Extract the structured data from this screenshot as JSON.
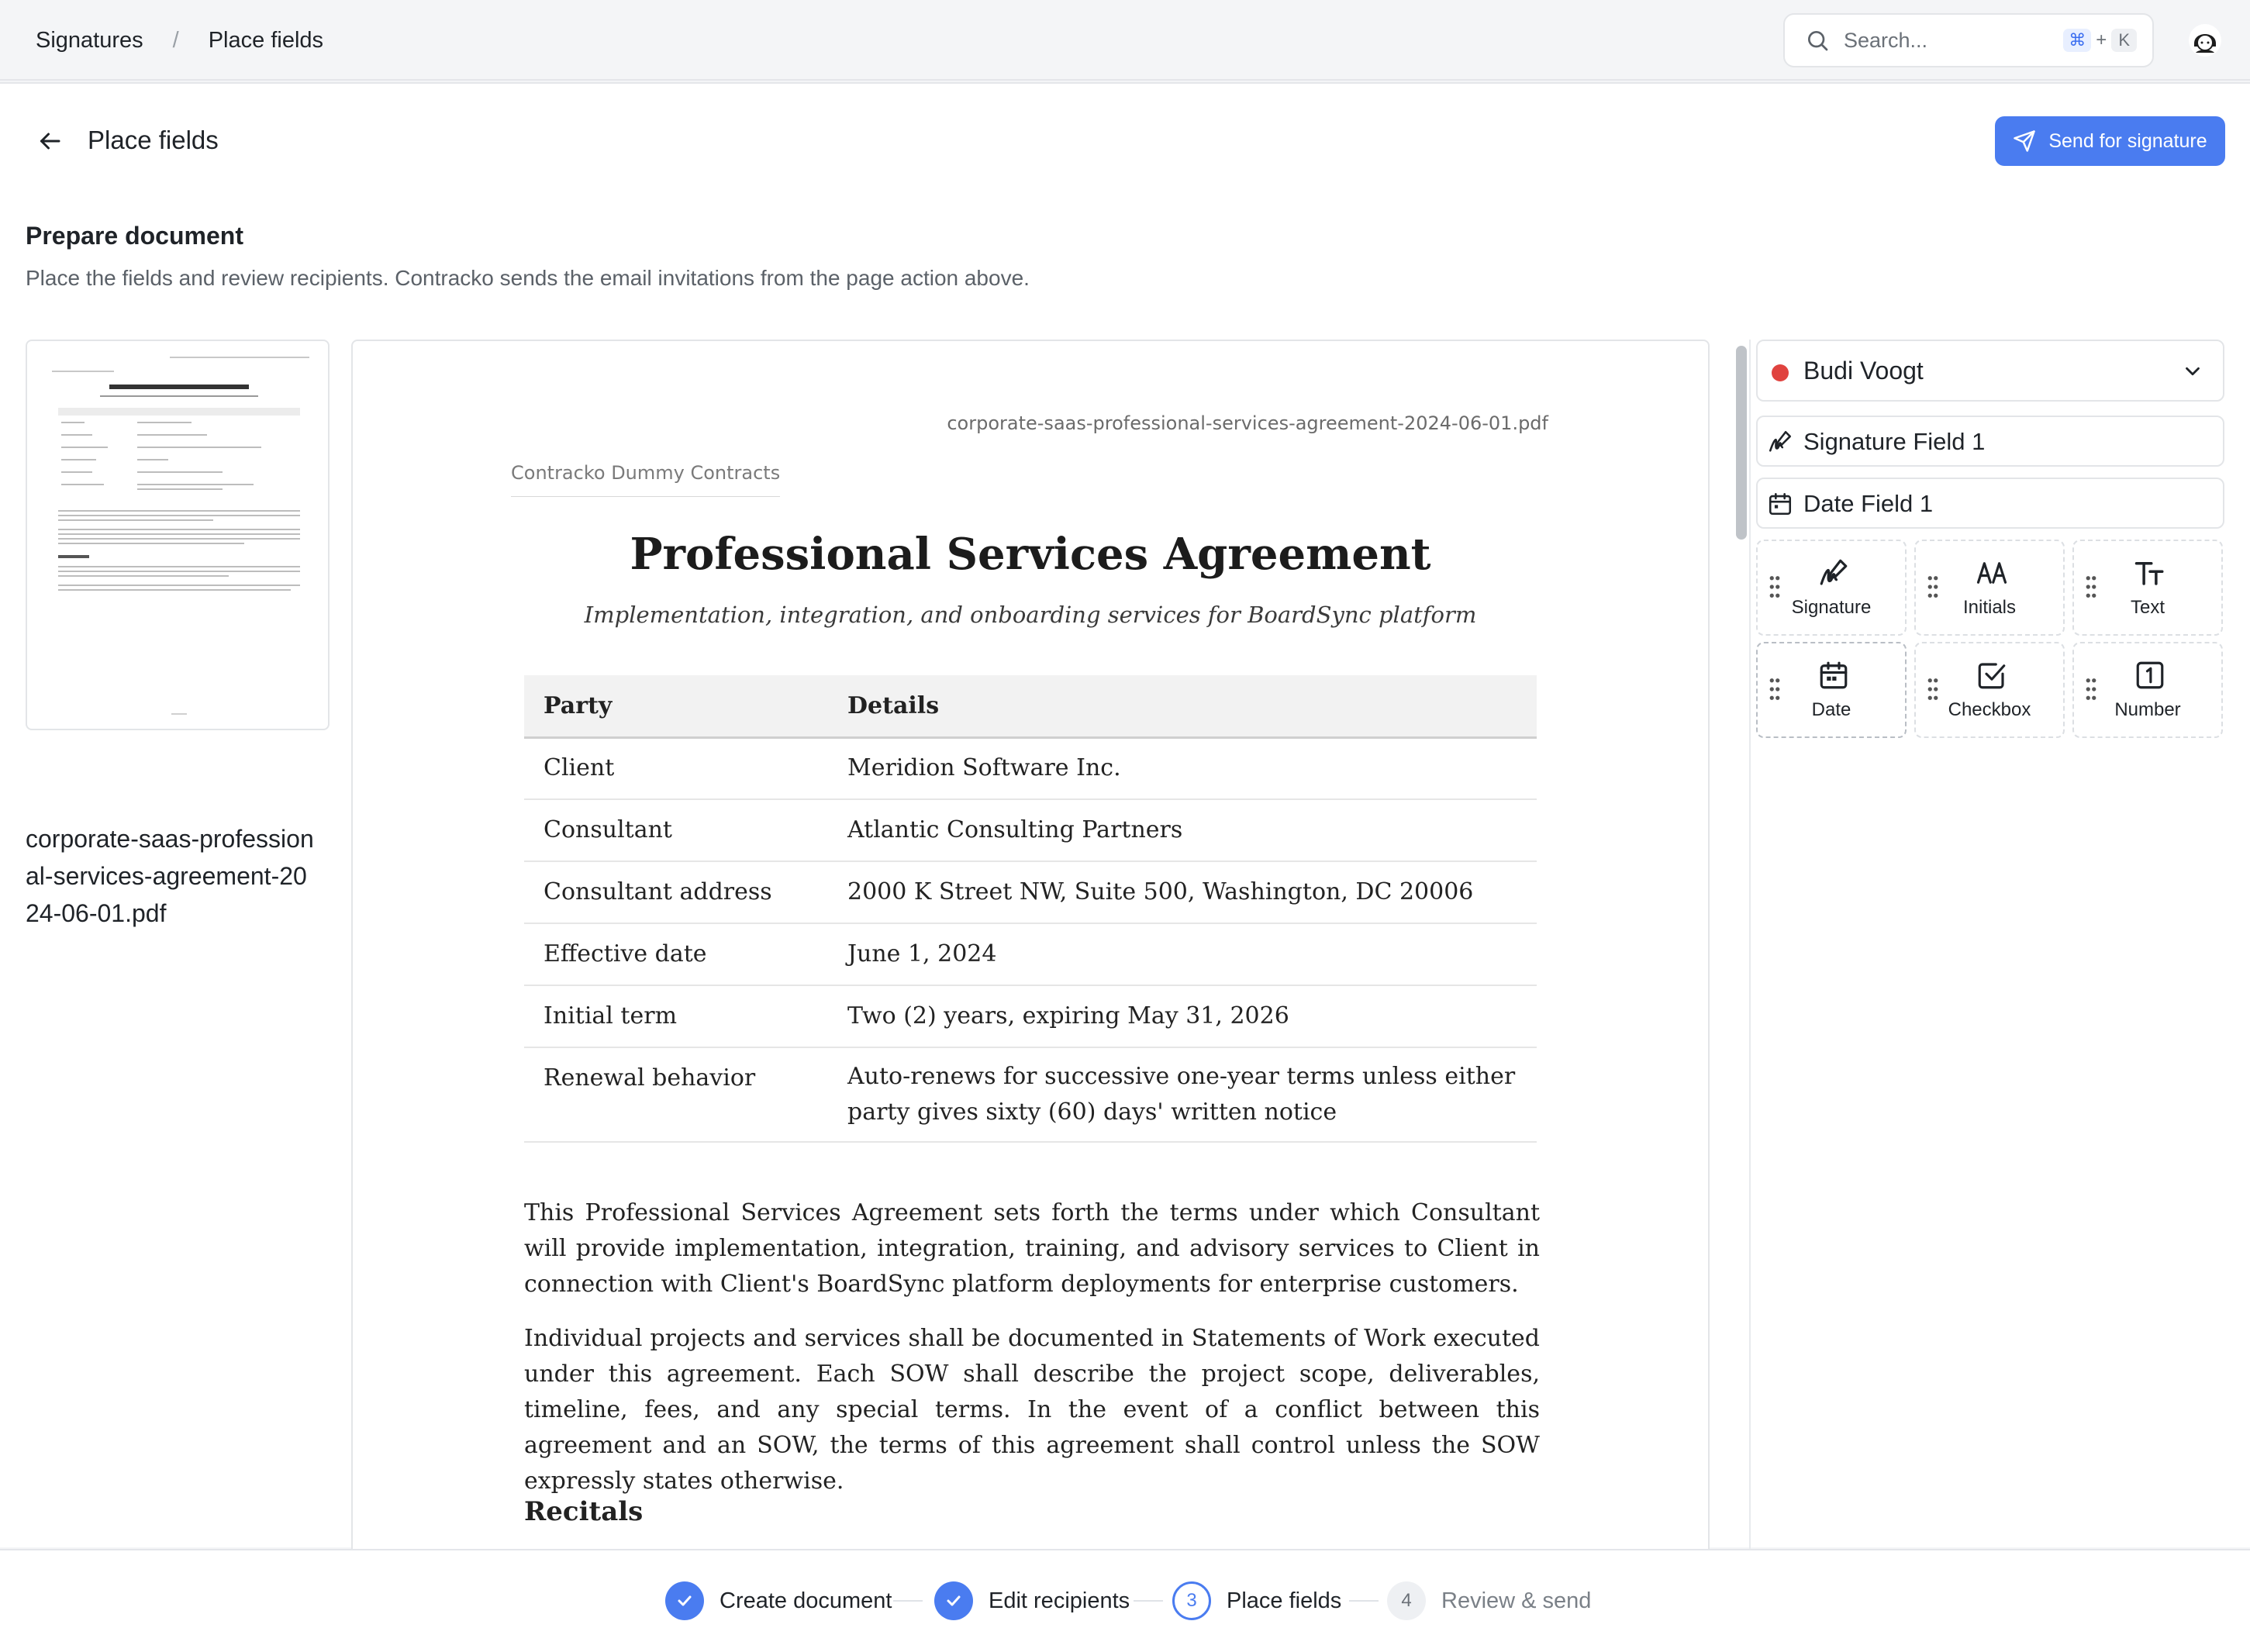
{
  "breadcrumb": {
    "root": "Signatures",
    "separator": "/",
    "current": "Place fields"
  },
  "search": {
    "placeholder": "Search...",
    "shortcut_modifier": "⌘",
    "shortcut_plus": "+",
    "shortcut_key": "K"
  },
  "header": {
    "title": "Place fields",
    "send_button": "Send for signature"
  },
  "section": {
    "title": "Prepare document",
    "subtitle": "Place the fields and review recipients. Contracko sends the email invitations from the page action above."
  },
  "thumbnail": {
    "file_name": "corporate-saas-professional-services-agreement-2024-06-01.pdf"
  },
  "document": {
    "file_name": "corporate-saas-professional-services-agreement-2024-06-01.pdf",
    "organization": "Contracko Dummy Contracts",
    "title": "Professional Services Agreement",
    "subtitle": "Implementation, integration, and onboarding services for BoardSync platform",
    "table_headers": [
      "Party",
      "Details"
    ],
    "table_rows": [
      [
        "Client",
        "Meridion Software Inc."
      ],
      [
        "Consultant",
        "Atlantic Consulting Partners"
      ],
      [
        "Consultant address",
        "2000 K Street NW, Suite 500, Washington, DC 20006"
      ],
      [
        "Effective date",
        "June 1, 2024"
      ],
      [
        "Initial term",
        "Two (2) years, expiring May 31, 2026"
      ],
      [
        "Renewal behavior",
        "Auto-renews for successive one-year terms unless either party gives sixty (60) days' written notice"
      ]
    ],
    "paragraphs": [
      "This Professional Services Agreement sets forth the terms under which Consultant will provide implementation, integration, training, and advisory services to Client in connection with Client's BoardSync platform deployments for enterprise customers.",
      "Individual projects and services shall be documented in Statements of Work executed under this agreement. Each SOW shall describe the project scope, deliverables, timeline, fees, and any special terms. In the event of a conflict between this agreement and an SOW, the terms of this agreement shall control unless the SOW expressly states otherwise."
    ],
    "section_heading": "Recitals"
  },
  "panel": {
    "recipient": {
      "name": "Budi Voogt",
      "color": "#e0433f"
    },
    "placed_fields": [
      {
        "label": "Signature Field 1",
        "icon": "signature-icon"
      },
      {
        "label": "Date Field 1",
        "icon": "calendar-icon"
      }
    ],
    "field_types": [
      {
        "label": "Signature",
        "icon": "signature-icon"
      },
      {
        "label": "Initials",
        "icon": "initials-icon"
      },
      {
        "label": "Text",
        "icon": "text-icon"
      },
      {
        "label": "Date",
        "icon": "calendar-icon"
      },
      {
        "label": "Checkbox",
        "icon": "checkbox-icon"
      },
      {
        "label": "Number",
        "icon": "number-icon"
      }
    ]
  },
  "stepper": {
    "steps": [
      {
        "label": "Create document",
        "state": "done",
        "number": "1"
      },
      {
        "label": "Edit recipients",
        "state": "done",
        "number": "2"
      },
      {
        "label": "Place fields",
        "state": "current",
        "number": "3"
      },
      {
        "label": "Review & send",
        "state": "todo",
        "number": "4"
      }
    ]
  },
  "colors": {
    "accent": "#4a7cf0",
    "recipient": "#e0433f"
  }
}
